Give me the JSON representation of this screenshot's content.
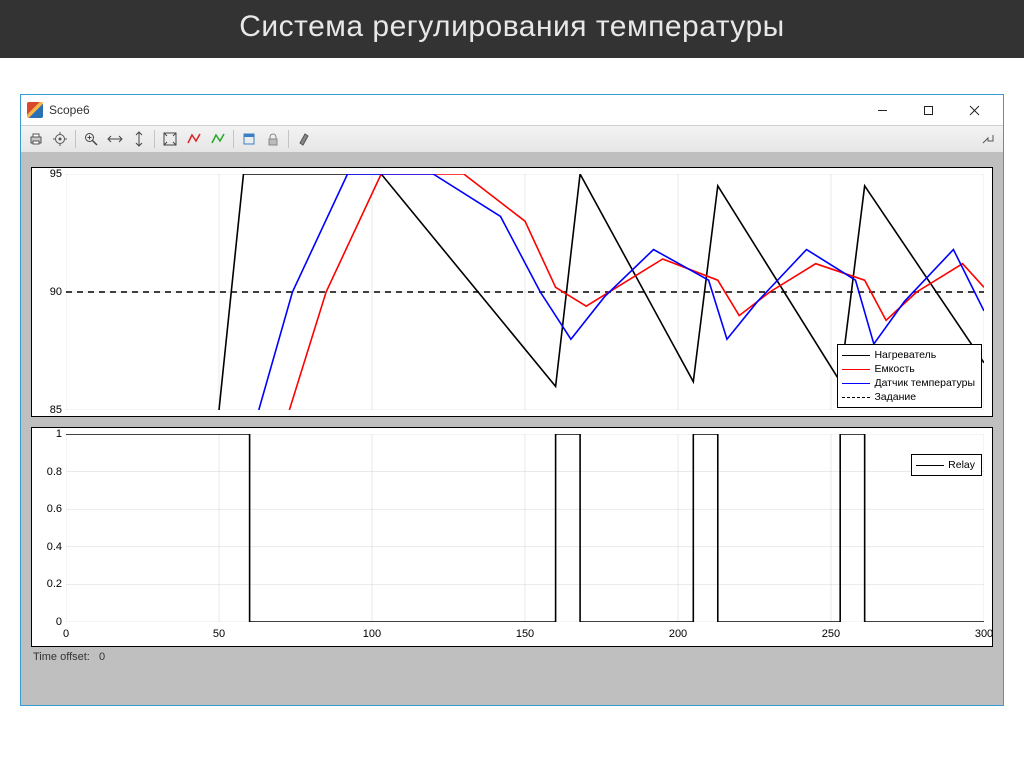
{
  "slide_title": "Система регулирования температуры",
  "window": {
    "title": "Scope6"
  },
  "status": {
    "label": "Time offset:",
    "value": "0"
  },
  "legend_top": {
    "heater": "Нагреватель",
    "capacity": "Емкость",
    "sensor": "Датчик температуры",
    "setpoint": "Задание"
  },
  "legend_bot": {
    "relay": "Relay"
  },
  "chart_data": [
    {
      "type": "line",
      "title": "",
      "xlim": [
        0,
        300
      ],
      "ylim": [
        85,
        95
      ],
      "xticks": [
        0,
        50,
        100,
        150,
        200,
        250,
        300
      ],
      "yticks": [
        85,
        90,
        95
      ],
      "grid": true,
      "legend_position": "bottom-right",
      "setpoint": 90,
      "series": [
        {
          "name": "Нагреватель",
          "color": "#000000",
          "x": [
            50,
            58,
            60,
            103,
            103,
            160,
            168,
            168,
            205,
            213,
            213,
            253,
            261,
            261,
            300
          ],
          "values": [
            85,
            95,
            95,
            95,
            95,
            86,
            95,
            95,
            86.2,
            94.5,
            94.5,
            86.2,
            94.5,
            94.5,
            87
          ]
        },
        {
          "name": "Емкость",
          "color": "#ff0000",
          "x": [
            73,
            85,
            103,
            130,
            150,
            160,
            170,
            180,
            195,
            213,
            220,
            230,
            245,
            261,
            268,
            278,
            293,
            300
          ],
          "values": [
            85,
            90,
            95,
            95,
            93,
            90.2,
            89.4,
            90.2,
            91.4,
            90.5,
            89,
            90,
            91.2,
            90.5,
            88.8,
            90,
            91.2,
            90.2
          ]
        },
        {
          "name": "Датчик температуры",
          "color": "#0000ff",
          "x": [
            63,
            74,
            92,
            120,
            142,
            155,
            165,
            176,
            192,
            210,
            216,
            226,
            242,
            258,
            264,
            274,
            290,
            300
          ],
          "values": [
            85,
            90,
            95,
            95,
            93.2,
            90,
            88,
            89.8,
            91.8,
            90.5,
            88,
            89.6,
            91.8,
            90.5,
            87.8,
            89.6,
            91.8,
            89.2
          ]
        },
        {
          "name": "Задание",
          "color": "#000000",
          "dash": true,
          "x": [
            0,
            300
          ],
          "values": [
            90,
            90
          ]
        }
      ]
    },
    {
      "type": "line",
      "title": "",
      "xlim": [
        0,
        300
      ],
      "ylim": [
        0,
        1
      ],
      "xticks": [
        0,
        50,
        100,
        150,
        200,
        250,
        300
      ],
      "yticks": [
        0,
        0.2,
        0.4,
        0.6,
        0.8,
        1
      ],
      "grid": true,
      "legend_position": "top-right",
      "series": [
        {
          "name": "Relay",
          "color": "#000000",
          "x": [
            0,
            60,
            60,
            160,
            160,
            168,
            168,
            205,
            205,
            213,
            213,
            253,
            253,
            261,
            261,
            300
          ],
          "values": [
            1,
            1,
            0,
            0,
            1,
            1,
            0,
            0,
            1,
            1,
            0,
            0,
            1,
            1,
            0,
            0
          ]
        }
      ]
    }
  ]
}
